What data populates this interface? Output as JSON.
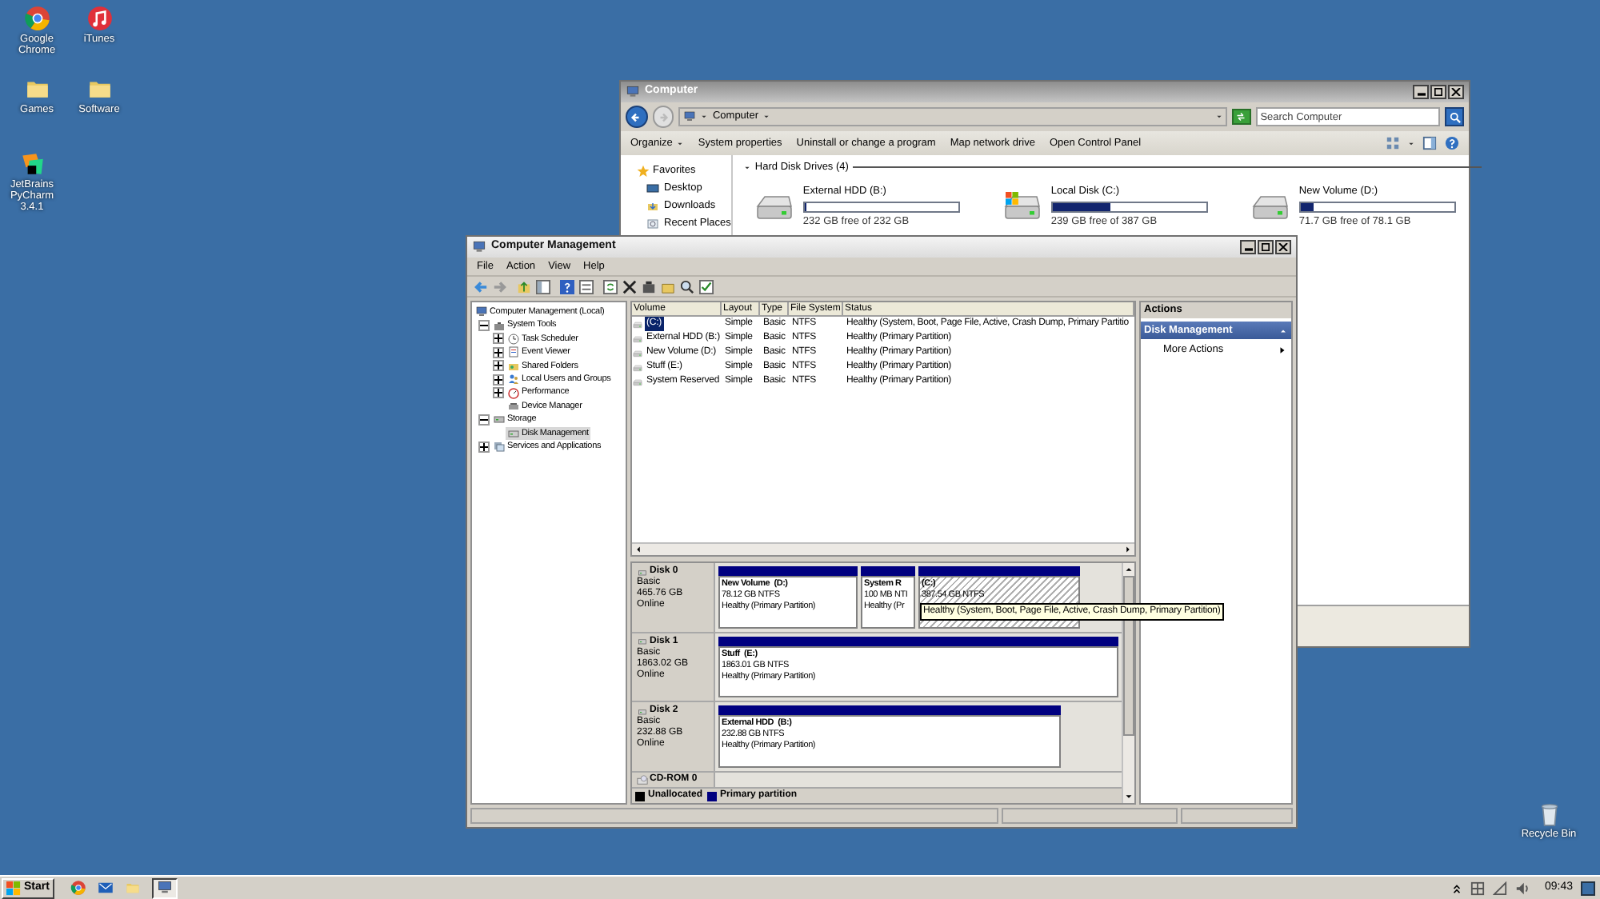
{
  "desktop": {
    "shortcuts": [
      {
        "label": "Google Chrome",
        "kind": "chrome"
      },
      {
        "label": "iTunes",
        "kind": "itunes"
      },
      {
        "label": "Games",
        "kind": "folder"
      },
      {
        "label": "Software",
        "kind": "folder"
      },
      {
        "label": "JetBrains PyCharm 3.4.1",
        "kind": "pycharm"
      },
      {
        "label": "Recycle Bin",
        "kind": "recycle"
      }
    ]
  },
  "explorer": {
    "title": "Computer",
    "breadcrumb": "Computer",
    "search": {
      "placeholder": "Search Computer"
    },
    "commands": [
      {
        "label": "Organize",
        "dropdown": true
      },
      {
        "label": "System properties",
        "dropdown": false
      },
      {
        "label": "Uninstall or change a program",
        "dropdown": false
      },
      {
        "label": "Map network drive",
        "dropdown": false
      },
      {
        "label": "Open Control Panel",
        "dropdown": false
      }
    ],
    "nav": {
      "title": "Favorites",
      "items": [
        {
          "label": "Desktop",
          "kind": "desktop"
        },
        {
          "label": "Downloads",
          "kind": "downloads"
        },
        {
          "label": "Recent Places",
          "kind": "recent"
        }
      ]
    },
    "group": "Hard Disk Drives (4)",
    "drives": [
      {
        "name": "External HDD (B:)",
        "free": "232 GB free of 232 GB",
        "level": 0.01,
        "kind": "drive"
      },
      {
        "name": "Local Disk (C:)",
        "free": "239 GB free of 387 GB",
        "level": 0.38,
        "kind": "system"
      },
      {
        "name": "New Volume (D:)",
        "free": "71.7 GB free of 78.1 GB",
        "level": 0.08,
        "kind": "drive"
      }
    ]
  },
  "computer_management": {
    "title": "Computer Management",
    "menu": [
      "File",
      "Action",
      "View",
      "Help"
    ],
    "tree": [
      {
        "label": "Computer Management (Local)",
        "kind": "computer",
        "selected": false,
        "children": [
          {
            "label": "System Tools",
            "kind": "tools",
            "expanded": true,
            "selected": false,
            "children": [
              {
                "label": "Task Scheduler",
                "kind": "clock",
                "expanded": false,
                "selected": false
              },
              {
                "label": "Event Viewer",
                "kind": "viewer",
                "expanded": false,
                "selected": false
              },
              {
                "label": "Shared Folders",
                "kind": "share",
                "expanded": false,
                "selected": false
              },
              {
                "label": "Local Users and Groups",
                "kind": "users",
                "expanded": false,
                "selected": false
              },
              {
                "label": "Performance",
                "kind": "performance",
                "expanded": false,
                "selected": false
              },
              {
                "label": "Device Manager",
                "kind": "device",
                "selected": false
              }
            ]
          },
          {
            "label": "Storage",
            "kind": "storage",
            "expanded": true,
            "selected": false,
            "children": [
              {
                "label": "Disk Management",
                "kind": "disk",
                "selected": true
              }
            ]
          },
          {
            "label": "Services and Applications",
            "kind": "services",
            "expanded": false,
            "selected": false
          }
        ]
      }
    ],
    "volumes": {
      "columns": [
        "Volume",
        "Layout",
        "Type",
        "File System",
        "Status"
      ],
      "rows": [
        {
          "cells": [
            "(C:)",
            "Simple",
            "Basic",
            "NTFS",
            "Healthy (System, Boot, Page File, Active, Crash Dump, Primary Partitio"
          ],
          "selected": true
        },
        {
          "cells": [
            "External HDD (B:)",
            "Simple",
            "Basic",
            "NTFS",
            "Healthy (Primary Partition)"
          ],
          "selected": false
        },
        {
          "cells": [
            "New Volume (D:)",
            "Simple",
            "Basic",
            "NTFS",
            "Healthy (Primary Partition)"
          ],
          "selected": false
        },
        {
          "cells": [
            "Stuff (E:)",
            "Simple",
            "Basic",
            "NTFS",
            "Healthy (Primary Partition)"
          ],
          "selected": false
        },
        {
          "cells": [
            "System Reserved",
            "Simple",
            "Basic",
            "NTFS",
            "Healthy (Primary Partition)"
          ],
          "selected": false
        }
      ]
    },
    "disks": [
      {
        "name": "Disk 0",
        "type": "Basic",
        "size": "465.76 GB",
        "status": "Online",
        "partitions": [
          {
            "name": "New Volume  (D:)",
            "size": "78.12 GB NTFS",
            "status": "Healthy (Primary Partition)",
            "selected": false
          },
          {
            "name": "System R",
            "size": "100 MB NTI",
            "status": "Healthy (Pr",
            "selected": false
          },
          {
            "name": "(C:)",
            "size": "387.54 GB NTFS",
            "selected": true
          }
        ]
      },
      {
        "name": "Disk 1",
        "type": "Basic",
        "size": "1863.02 GB",
        "status": "Online",
        "partitions": [
          {
            "name": "Stuff  (E:)",
            "size": "1863.01 GB NTFS",
            "status": "Healthy (Primary Partition)",
            "selected": false
          }
        ]
      },
      {
        "name": "Disk 2",
        "type": "Basic",
        "size": "232.88 GB",
        "status": "Online",
        "partitions": [
          {
            "name": "External HDD  (B:)",
            "size": "232.88 GB NTFS",
            "status": "Healthy (Primary Partition)",
            "selected": false
          }
        ]
      }
    ],
    "cdrom": "CD-ROM 0",
    "legend": [
      {
        "label": "Unallocated",
        "color": "#000000"
      },
      {
        "label": "Primary partition",
        "color": "#000080"
      }
    ],
    "actions": {
      "title": "Actions",
      "section": "Disk Management",
      "items": [
        "More Actions"
      ]
    },
    "tooltip": "Healthy (System, Boot, Page File, Active, Crash Dump, Primary Partition)"
  },
  "taskbar": {
    "start": "Start",
    "quick_launch": [
      {
        "kind": "chrome"
      },
      {
        "kind": "outlook"
      },
      {
        "kind": "explorer"
      }
    ],
    "tasks": [
      {
        "kind": "management",
        "selected": true
      }
    ],
    "clock": "09:43"
  }
}
